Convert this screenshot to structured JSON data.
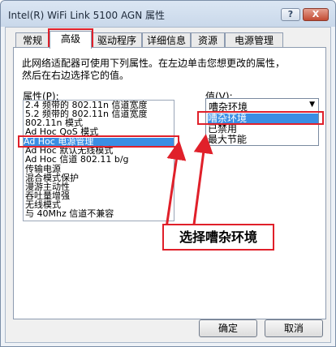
{
  "window": {
    "title": "Intel(R) WiFi Link 5100 AGN 属性",
    "help_label": "?",
    "close_label": "X"
  },
  "tabs": [
    "常规",
    "高级",
    "驱动程序",
    "详细信息",
    "资源",
    "电源管理"
  ],
  "description": [
    "此网络适配器可使用下列属性。在左边单击您想更改的属性，",
    "然后在右边选择它的值。"
  ],
  "property_label": "属性(P):",
  "value_label": "值(V):",
  "properties": [
    "2.4 频带的 802.11n 信道宽度",
    "5.2 频带的 802.11n 信道宽度",
    "802.11n 模式",
    "Ad Hoc QoS 模式",
    "Ad Hoc 电源管理",
    "Ad Hoc 默认无线模式",
    "Ad Hoc 信道 802.11 b/g",
    "传输电源",
    "混合模式保护",
    "漫游主动性",
    "吞吐量增强",
    "无线模式",
    "与 40Mhz 信道不兼容"
  ],
  "selected_property": "Ad Hoc 电源管理",
  "value": {
    "selected": "嘈杂环境",
    "arrow": "▼",
    "options": [
      "嘈杂环境",
      "已禁用",
      "最大节能"
    ]
  },
  "callout_text": "选择嘈杂环境",
  "buttons": {
    "ok": "确定",
    "cancel": "取消"
  },
  "colors": {
    "highlight": "#3a8ee3",
    "annotation_red": "#e0202a"
  }
}
